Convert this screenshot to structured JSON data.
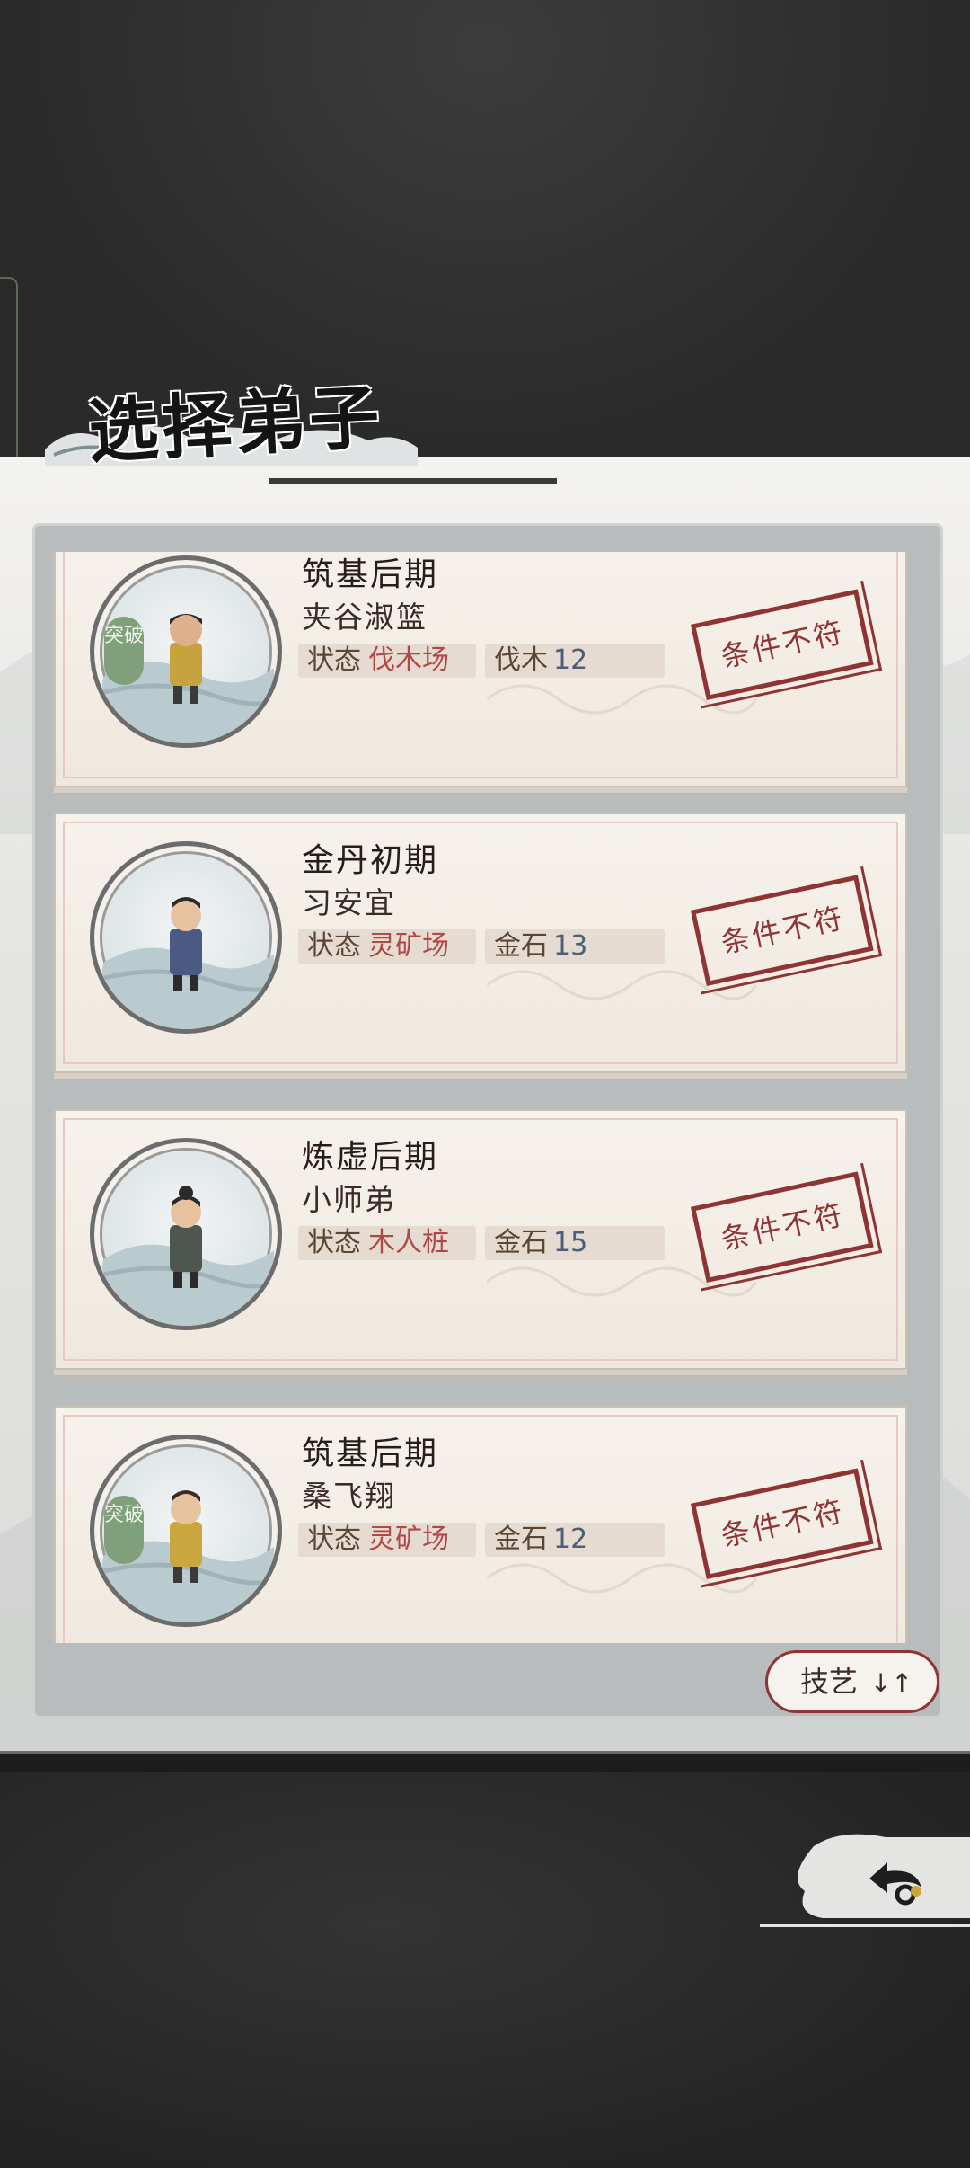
{
  "title": "选择弟子",
  "disciples": [
    {
      "realm": "筑基后期",
      "name": "夹谷淑篮",
      "status_label": "状态",
      "status": "伐木场",
      "resource": "伐木",
      "resource_value": "12",
      "breakthrough": "突破",
      "stamp": "条件不符"
    },
    {
      "realm": "金丹初期",
      "name": "习安宜",
      "status_label": "状态",
      "status": "灵矿场",
      "resource": "金石",
      "resource_value": "13",
      "breakthrough": "",
      "stamp": "条件不符"
    },
    {
      "realm": "炼虚后期",
      "name": "小师弟",
      "status_label": "状态",
      "status": "木人桩",
      "resource": "金石",
      "resource_value": "15",
      "breakthrough": "",
      "stamp": "条件不符"
    },
    {
      "realm": "筑基后期",
      "name": "桑飞翔",
      "status_label": "状态",
      "status": "灵矿场",
      "resource": "金石",
      "resource_value": "12",
      "breakthrough": "突破",
      "stamp": "条件不符"
    }
  ],
  "sort_button": {
    "label": "技艺",
    "icon": "↓↑"
  },
  "icons": {
    "back": "back-arrow-icon",
    "avatar": "disciple-avatar-icon"
  },
  "colors": {
    "stamp": "#8e3434",
    "status_value": "#b04848",
    "resource_value": "#4d5f78",
    "breakthrough_badge": "#7fa07a"
  }
}
